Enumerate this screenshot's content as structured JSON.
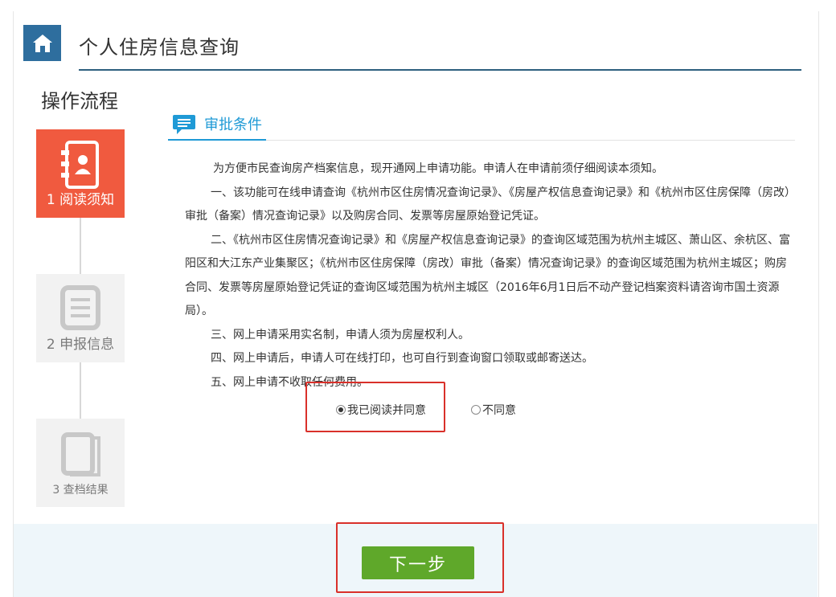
{
  "header": {
    "title": "个人住房信息查询"
  },
  "flow": {
    "title": "操作流程",
    "steps": [
      {
        "label": "1 阅读须知",
        "icon": "contact-book-icon",
        "state": "active"
      },
      {
        "label": "2 申报信息",
        "icon": "document-list-icon",
        "state": "inactive"
      },
      {
        "label": "3  查档结果",
        "icon": "book-icon",
        "state": "inactive"
      }
    ]
  },
  "section": {
    "title": "审批条件",
    "icon": "message-icon"
  },
  "notice": {
    "paragraphs": [
      "为方便市民查询房产档案信息，现开通网上申请功能。申请人在申请前须仔细阅读本须知。",
      "一、该功能可在线申请查询《杭州市区住房情况查询记录》、《房屋产权信息查询记录》和《杭州市区住房保障（房改）审批（备案）情况查询记录》以及购房合同、发票等房屋原始登记凭证。",
      "二、《杭州市区住房情况查询记录》和《房屋产权信息查询记录》的查询区域范围为杭州主城区、萧山区、余杭区、富阳区和大江东产业集聚区；《杭州市区住房保障（房改）审批（备案）情况查询记录》的查询区域范围为杭州主城区；购房合同、发票等房屋原始登记凭证的查询区域范围为杭州主城区（2016年6月1日后不动产登记档案资料请咨询市国土资源局）。",
      "三、网上申请采用实名制，申请人须为房屋权利人。",
      "四、网上申请后，申请人可在线打印，也可自行到查询窗口领取或邮寄送达。",
      "五、网上申请不收取任何费用。"
    ]
  },
  "consent": {
    "agree_label": "我已阅读并同意",
    "disagree_label": "不同意",
    "selected": "agree"
  },
  "actions": {
    "next_label": "下一步"
  },
  "colors": {
    "active_step": "#f05a3f",
    "accent_blue": "#1f9ad6",
    "next_button": "#5fa82a",
    "highlight_red": "#d9302a"
  }
}
